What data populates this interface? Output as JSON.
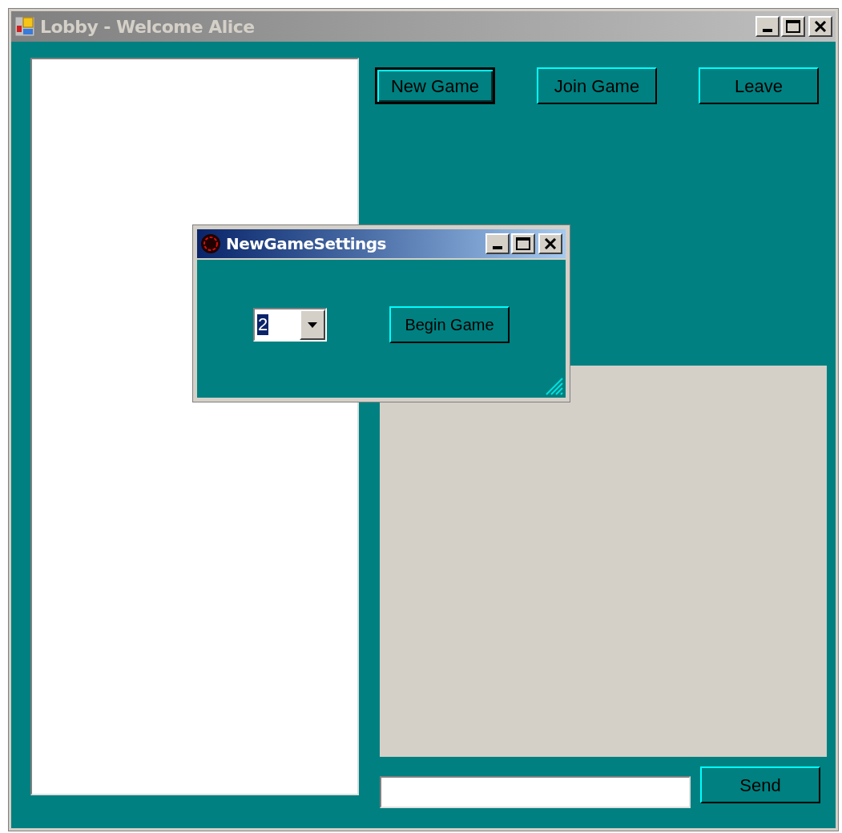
{
  "window": {
    "title": "Lobby - Welcome Alice",
    "active": false
  },
  "buttons": [
    {
      "label": "New Game",
      "focused": true
    },
    {
      "label": "Join Game",
      "focused": false
    },
    {
      "label": "Leave",
      "focused": false
    }
  ],
  "chat": {
    "send_button": "Send"
  },
  "dialog": {
    "title": "NewGameSettings",
    "active": true,
    "players": {
      "value": "2",
      "value_selected": true
    },
    "begin_button": "Begin Game"
  }
}
